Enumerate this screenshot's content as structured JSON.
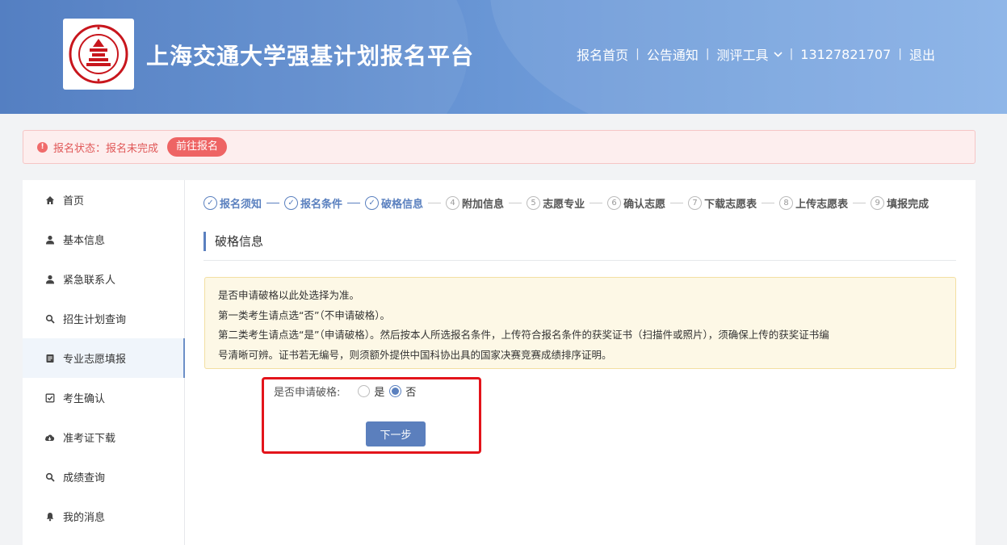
{
  "header": {
    "site_title": "上海交通大学强基计划报名平台",
    "nav": {
      "home": "报名首页",
      "notice": "公告通知",
      "tools": "测评工具",
      "phone": "13127821707",
      "logout": "退出"
    }
  },
  "alert": {
    "message": "报名状态：报名未完成",
    "action": "前往报名"
  },
  "sidebar": {
    "items": [
      {
        "label": "首页",
        "icon": "home-icon"
      },
      {
        "label": "基本信息",
        "icon": "user-icon"
      },
      {
        "label": "紧急联系人",
        "icon": "user-icon"
      },
      {
        "label": "招生计划查询",
        "icon": "search-icon"
      },
      {
        "label": "专业志愿填报",
        "icon": "document-icon",
        "active": true
      },
      {
        "label": "考生确认",
        "icon": "checkbox-icon"
      },
      {
        "label": "准考证下载",
        "icon": "cloud-download-icon"
      },
      {
        "label": "成绩查询",
        "icon": "search-icon"
      },
      {
        "label": "我的消息",
        "icon": "bell-icon"
      }
    ]
  },
  "steps": [
    {
      "num": "✓",
      "label": "报名须知",
      "done": true
    },
    {
      "num": "✓",
      "label": "报名条件",
      "done": true
    },
    {
      "num": "✓",
      "label": "破格信息",
      "done": true
    },
    {
      "num": "4",
      "label": "附加信息",
      "done": false
    },
    {
      "num": "5",
      "label": "志愿专业",
      "done": false
    },
    {
      "num": "6",
      "label": "确认志愿",
      "done": false
    },
    {
      "num": "7",
      "label": "下载志愿表",
      "done": false
    },
    {
      "num": "8",
      "label": "上传志愿表",
      "done": false
    },
    {
      "num": "9",
      "label": "填报完成",
      "done": false
    }
  ],
  "section_title": "破格信息",
  "notice": {
    "line1": "是否申请破格以此处选择为准。",
    "line2": "第一类考生请点选“否”（不申请破格）。",
    "line3": "第二类考生请点选“是”（申请破格）。然后按本人所选报名条件，上传符合报名条件的获奖证书（扫描件或照片），须确保上传的获奖证书编",
    "line4": "号清晰可辨。证书若无编号，则须额外提供中国科协出具的国家决赛竞赛成绩排序证明。"
  },
  "form": {
    "label": "是否申请破格:",
    "option_yes": "是",
    "option_no": "否",
    "selected": "否",
    "next_button": "下一步"
  },
  "colors": {
    "accent": "#5a80bf",
    "alert_text": "#e05757",
    "highlight_box": "#e3141b"
  }
}
